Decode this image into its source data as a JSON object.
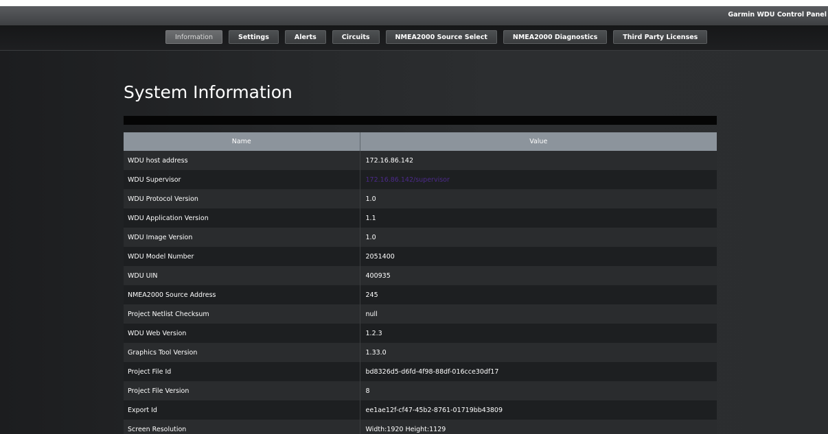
{
  "app": {
    "title": "Garmin WDU Control Panel"
  },
  "nav": {
    "tabs": [
      {
        "label": "Information",
        "active": true
      },
      {
        "label": "Settings"
      },
      {
        "label": "Alerts"
      },
      {
        "label": "Circuits"
      },
      {
        "label": "NMEA2000 Source Select"
      },
      {
        "label": "NMEA2000 Diagnostics"
      },
      {
        "label": "Third Party Licenses"
      }
    ]
  },
  "main": {
    "title": "System Information",
    "table": {
      "headers": [
        "Name",
        "Value"
      ],
      "rows": [
        {
          "name": "WDU host address",
          "value": "172.16.86.142"
        },
        {
          "name": "WDU Supervisor",
          "value": "172.16.86.142/supervisor",
          "link": true
        },
        {
          "name": "WDU Protocol Version",
          "value": "1.0"
        },
        {
          "name": "WDU Application Version",
          "value": "1.1"
        },
        {
          "name": "WDU Image Version",
          "value": "1.0"
        },
        {
          "name": "WDU Model Number",
          "value": "2051400"
        },
        {
          "name": "WDU UIN",
          "value": "400935"
        },
        {
          "name": "NMEA2000 Source Address",
          "value": "245"
        },
        {
          "name": "Project Netlist Checksum",
          "value": "null"
        },
        {
          "name": "WDU Web Version",
          "value": "1.2.3"
        },
        {
          "name": "Graphics Tool Version",
          "value": "1.33.0"
        },
        {
          "name": "Project File Id",
          "value": "bd8326d5-d6fd-4f98-88df-016cce30df17"
        },
        {
          "name": "Project File Version",
          "value": "8"
        },
        {
          "name": "Export Id",
          "value": "ee1ae12f-cf47-45b2-8761-01719bb43809"
        },
        {
          "name": "Screen Resolution",
          "value": "Width:1920 Height:1129"
        }
      ]
    }
  },
  "colors": {
    "link": "#4c2a8a",
    "header_bg": "#8c949c"
  }
}
